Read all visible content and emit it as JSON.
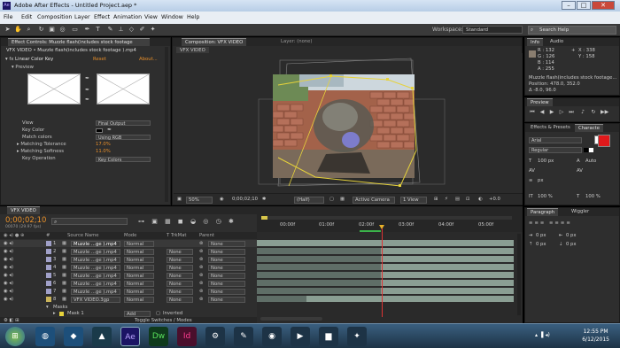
{
  "window": {
    "title": "Adobe After Effects - Untitled Project.aep *",
    "logo": "Ae"
  },
  "menu": [
    "File",
    "Edit",
    "Composition",
    "Layer",
    "Effect",
    "Animation",
    "View",
    "Window",
    "Help"
  ],
  "toolbar": {
    "tools": [
      "selection-tool",
      "hand-tool",
      "zoom-tool",
      "rotate-tool",
      "camera-tool",
      "pan-behind-tool",
      "rectangle-tool",
      "pen-tool",
      "type-tool",
      "brush-tool",
      "clone-stamp-tool",
      "eraser-tool",
      "roto-brush-tool",
      "puppet-tool"
    ],
    "workspace_label": "Workspace:",
    "workspace_value": "Standard",
    "search_placeholder": "Search Help"
  },
  "effect_controls": {
    "tab_label": "Effect Controls: Muzzle flash(includes stock footage",
    "breadcrumb": "VFX VIDEO • Muzzle flash(includes stock footage ).mp4",
    "effect_name": "Linear Color Key",
    "reset": "Reset",
    "about": "About...",
    "preview_label": "Preview",
    "rows": [
      {
        "label": "View",
        "value": "Final Output"
      },
      {
        "label": "Key Color",
        "value": ""
      },
      {
        "label": "Match colors",
        "value": "Using RGB"
      },
      {
        "label": "Matching Tolerance",
        "value": "17.0%"
      },
      {
        "label": "Matching Softness",
        "value": "11.0%"
      },
      {
        "label": "Key Operation",
        "value": "Key Colors"
      }
    ]
  },
  "composition": {
    "tab_label": "Composition: VFX VIDEO",
    "layer_tab": "Layer: (none)",
    "comp_name": "VFX VIDEO",
    "zoom": "50%",
    "timecode": "0;00;02;10",
    "resolution": "(Half)",
    "camera": "Active Camera",
    "view": "1 View",
    "exposure": "+0.0"
  },
  "info": {
    "tab_info": "Info",
    "tab_audio": "Audio",
    "r": "R : 132",
    "g": "G : 126",
    "b": "B : 114",
    "a": "A : 255",
    "x": "X : 338",
    "y": "Y : 158",
    "layer": "Muzzle flash(includes stock footage...",
    "position": "Position: 478.0, 352.0",
    "delta": "Δ -8.0, 96.0"
  },
  "preview": {
    "tab": "Preview"
  },
  "effects_presets": {
    "tab": "Effects & Presets",
    "char_tab": "Characte"
  },
  "character": {
    "font": "Arial",
    "style": "Regular",
    "size": "100 px",
    "leading": "Auto",
    "scale_v": "100 %",
    "scale_h": "100 %",
    "baseline": "0 px",
    "tsume": "0 %",
    "px_label": "px"
  },
  "paragraph": {
    "tab": "Paragraph",
    "wiggler_tab": "Wiggler",
    "px": "0 px"
  },
  "timeline": {
    "tab": "VFX VIDEO",
    "timecode": "0;00;02;10",
    "frames": "00070 (29.97 fps)",
    "search_placeholder": "",
    "columns": [
      "Source Name",
      "Mode",
      "T TrkMat",
      "Parent"
    ],
    "ruler": [
      "00:00f",
      "01:00f",
      "02:00f",
      "03:00f",
      "04:00f",
      "05:00f"
    ],
    "layers": [
      {
        "num": "1",
        "name": "Muzzle ...ge ).mp4",
        "mode": "Normal",
        "trk": "",
        "parent": "None"
      },
      {
        "num": "2",
        "name": "Muzzle ...ge ).mp4",
        "mode": "Normal",
        "trk": "None",
        "parent": "None"
      },
      {
        "num": "3",
        "name": "Muzzle ...ge ).mp4",
        "mode": "Normal",
        "trk": "None",
        "parent": "None"
      },
      {
        "num": "4",
        "name": "Muzzle ...ge ).mp4",
        "mode": "Normal",
        "trk": "None",
        "parent": "None"
      },
      {
        "num": "5",
        "name": "Muzzle ...ge ).mp4",
        "mode": "Normal",
        "trk": "None",
        "parent": "None"
      },
      {
        "num": "6",
        "name": "Muzzle ...ge ).mp4",
        "mode": "Normal",
        "trk": "None",
        "parent": "None"
      },
      {
        "num": "7",
        "name": "Muzzle ...ge ).mp4",
        "mode": "Normal",
        "trk": "None",
        "parent": "None"
      },
      {
        "num": "8",
        "name": "VFX VIDEO.3gp",
        "mode": "Normal",
        "trk": "None",
        "parent": "None"
      }
    ],
    "masks_label": "Masks",
    "mask1": "Mask 1",
    "mask_mode": "Add",
    "inverted": "Inverted",
    "toggle": "Toggle Switches / Modes"
  },
  "taskbar": {
    "apps": [
      "start",
      "firefox",
      "windows-explorer",
      "media-encoder",
      "after-effects",
      "dreamweaver",
      "indesign",
      "settings",
      "paint",
      "chrome",
      "media-player",
      "folder",
      "premiere"
    ],
    "ae_label": "Ae",
    "dw_label": "Dw",
    "id_label": "Id",
    "time": "12:55 PM",
    "date": "6/12/2015"
  }
}
